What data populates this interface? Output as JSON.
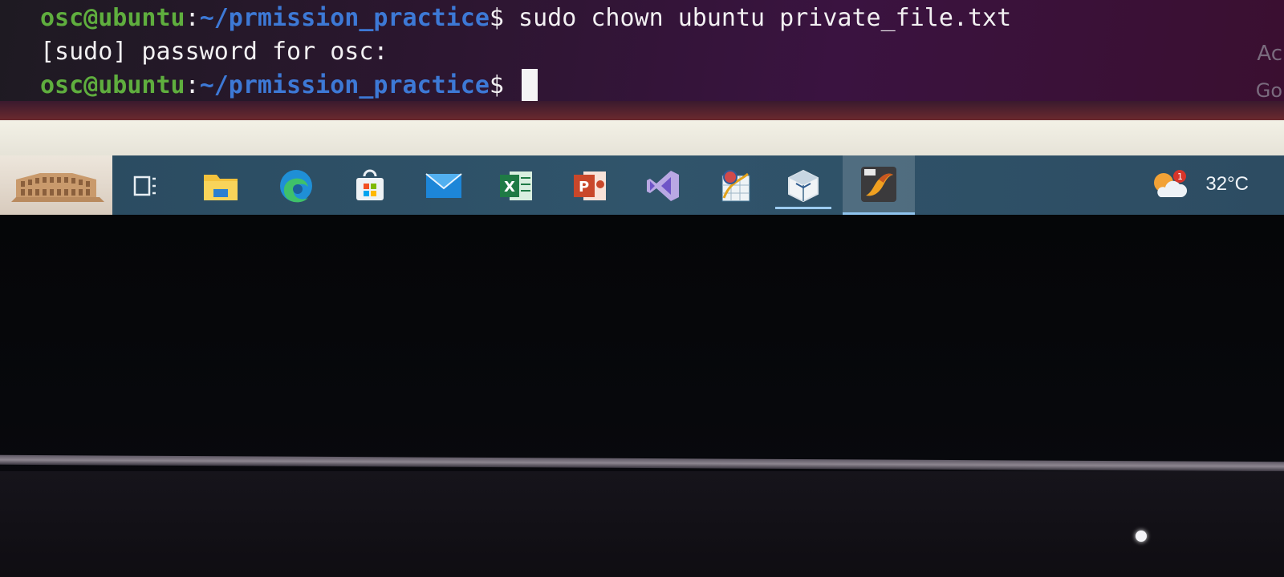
{
  "terminal": {
    "line1": {
      "user": "osc@ubuntu",
      "colon": ":",
      "path": "~/prmission_practice",
      "prompt": "$",
      "command": " sudo chown ubuntu private_file.txt"
    },
    "line2": {
      "text": "[sudo] password for osc:"
    },
    "line3": {
      "user": "osc@ubuntu",
      "colon": ":",
      "path": "~/prmission_practice",
      "prompt": "$"
    },
    "side_text_1": "Ac",
    "side_text_2": "Go"
  },
  "taskbar": {
    "pinned": [
      {
        "name": "task-view-icon"
      },
      {
        "name": "file-explorer-icon"
      },
      {
        "name": "edge-icon"
      },
      {
        "name": "store-icon"
      },
      {
        "name": "mail-icon"
      },
      {
        "name": "excel-icon"
      },
      {
        "name": "powerpoint-icon"
      },
      {
        "name": "visual-studio-icon"
      },
      {
        "name": "geogebra-icon"
      },
      {
        "name": "virtualbox-icon"
      },
      {
        "name": "matlab-icon"
      }
    ],
    "weather": {
      "badge": "1",
      "temperature": "32°C"
    }
  },
  "colors": {
    "user": "#5fae3e",
    "path": "#3d79d6",
    "taskbar": "#2d4f66",
    "running_indicator": "#9ccbf0"
  }
}
